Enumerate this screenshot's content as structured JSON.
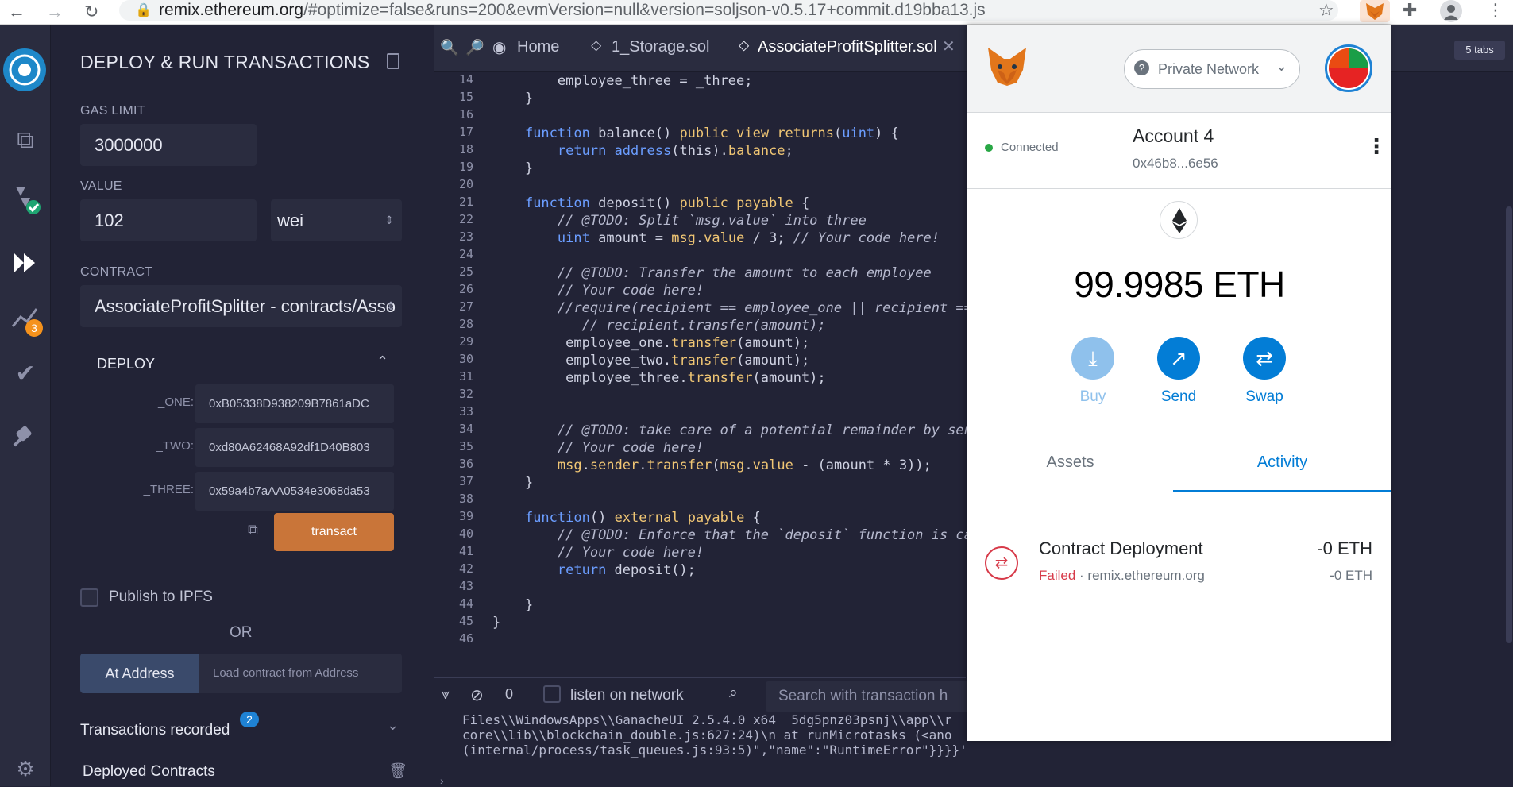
{
  "browser": {
    "url_host": "remix.ethereum.org",
    "url_rest": "/#optimize=false&runs=200&evmVersion=null&version=soljson-v0.5.17+commit.d19bba13.js",
    "tabs_badge": "5 tabs"
  },
  "rail": {
    "analysis_badge": "3"
  },
  "panel": {
    "title": "DEPLOY & RUN TRANSACTIONS",
    "gas_limit_label": "GAS LIMIT",
    "gas_limit_value": "3000000",
    "value_label": "VALUE",
    "value_amount": "102",
    "value_unit": "wei",
    "contract_label": "CONTRACT",
    "contract_value": "AssociateProfitSplitter - contracts/Asso",
    "deploy_label": "DEPLOY",
    "args": [
      {
        "label": "_ONE:",
        "value": "0xB05338D938209B7861aDC"
      },
      {
        "label": "_TWO:",
        "value": "0xd80A62468A92df1D40B803"
      },
      {
        "label": "_THREE:",
        "value": "0x59a4b7aAA0534e3068da53"
      }
    ],
    "transact_label": "transact",
    "publish_label": "Publish to IPFS",
    "or_label": "OR",
    "at_address_label": "At Address",
    "load_placeholder": "Load contract from Address",
    "tx_recorded_label": "Transactions recorded",
    "tx_recorded_count": "2",
    "deployed_label": "Deployed Contracts"
  },
  "editor": {
    "tab_home": "Home",
    "tab_storage": "1_Storage.sol",
    "tab_splitter": "AssociateProfitSplitter.sol",
    "line_numbers": [
      "14",
      "15",
      "16",
      "17",
      "18",
      "19",
      "20",
      "21",
      "22",
      "23",
      "24",
      "25",
      "26",
      "27",
      "28",
      "29",
      "30",
      "31",
      "32",
      "33",
      "34",
      "35",
      "36",
      "37",
      "38",
      "39",
      "40",
      "41",
      "42",
      "43",
      "44",
      "45",
      "46"
    ],
    "lines": [
      "        employee_three = _three;",
      "    }",
      "",
      "    function balance() public view returns(uint) {",
      "        return address(this).balance;",
      "    }",
      "",
      "    function deposit() public payable {",
      "        // @TODO: Split `msg.value` into three",
      "        uint amount = msg.value / 3; // Your code here!",
      "",
      "        // @TODO: Transfer the amount to each employee",
      "        // Your code here!",
      "        //require(recipient == employee_one || recipient ==",
      "           // recipient.transfer(amount);",
      "         employee_one.transfer(amount);",
      "         employee_two.transfer(amount);",
      "         employee_three.transfer(amount);",
      "",
      "",
      "        // @TODO: take care of a potential remainder by send",
      "        // Your code here!",
      "        msg.sender.transfer(msg.value - (amount * 3));",
      "    }",
      "",
      "    function() external payable {",
      "        // @TODO: Enforce that the `deposit` function is cal",
      "        // Your code here!",
      "        return deposit();",
      "",
      "    }",
      "}",
      ""
    ]
  },
  "terminal": {
    "count": "0",
    "listen_label": "listen on network",
    "search_placeholder": "Search with transaction h",
    "log": [
      "Files\\\\WindowsApps\\\\GanacheUI_2.5.4.0_x64__5dg5pnz03psnj\\\\app\\\\r",
      "core\\\\lib\\\\blockchain_double.js:627:24)\\n at runMicrotasks (<ano",
      "(internal/process/task_queues.js:93:5)\",\"name\":\"RuntimeError\"}}}}'"
    ]
  },
  "metamask": {
    "network": "Private Network",
    "connected_label": "Connected",
    "account_name": "Account 4",
    "account_address": "0x46b8...6e56",
    "balance": "99.9985 ETH",
    "actions": {
      "buy": "Buy",
      "send": "Send",
      "swap": "Swap"
    },
    "tab_assets": "Assets",
    "tab_activity": "Activity",
    "tx": {
      "title": "Contract Deployment",
      "status": "Failed",
      "origin": "remix.ethereum.org",
      "amount": "-0 ETH",
      "amount_sub": "-0 ETH"
    }
  }
}
